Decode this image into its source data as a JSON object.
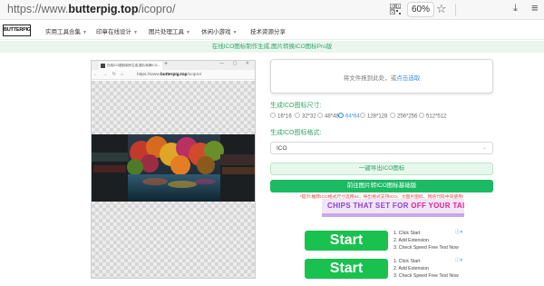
{
  "browser": {
    "url_prefix": "https://www.",
    "url_domain": "butterpig.top",
    "url_path": "/icopro/",
    "zoom": "60%"
  },
  "site": {
    "logo": "BUTTERPIG",
    "nav": [
      {
        "label": "实用工具合集"
      },
      {
        "label": "印章在线设计"
      },
      {
        "label": "图片处理工具"
      },
      {
        "label": "休闲小游戏"
      },
      {
        "label": "技术资源分享"
      }
    ],
    "banner": "在线ICO图标制作生成,图片转换ICO图标Pro版"
  },
  "preview": {
    "tab_title": "在线ICO图标制作生成,图片转换ICO...",
    "url_prefix": "https://www.",
    "url_domain": "butterpig.top",
    "url_path": "/icopro/"
  },
  "panel": {
    "upload_text": "将文件拖到此处，或",
    "upload_link": "点击选取",
    "size_label": "生成ICO图标尺寸:",
    "sizes": [
      {
        "label": "16*16",
        "checked": false
      },
      {
        "label": "32*32",
        "checked": false
      },
      {
        "label": "48*48",
        "checked": false
      },
      {
        "label": "64*64",
        "checked": true
      },
      {
        "label": "128*128",
        "checked": false
      },
      {
        "label": "256*256",
        "checked": false
      },
      {
        "label": "512*512",
        "checked": false
      }
    ],
    "format_label": "生成ICO图标格式:",
    "format_value": "ICO",
    "generate_button": "一键导出ICO图标",
    "png_button": "前往图片转ICO图标基础版",
    "notice": "*提示:推荐ICO格式尺寸选用64，导出格式支持ICO、大图片图标、网络代码中间使用!"
  },
  "ads": {
    "banner_text_a": "CHIPS THAT SET FOR ",
    "banner_text_b": "OFF YOUR TAIL",
    "cards": [
      {
        "button": "Start",
        "steps": [
          "1. Click Start",
          "2. Add Extension",
          "3. Check Speed Free Test Now"
        ]
      },
      {
        "button": "Start",
        "steps": [
          "1. Click Start",
          "2. Add Extension",
          "3. Check Speed Free Test Now"
        ]
      }
    ]
  },
  "colors": {
    "accent_green": "#1cba63",
    "label_green": "#2fa365",
    "link_blue": "#3a8ee6",
    "warning_red": "#e04848"
  }
}
